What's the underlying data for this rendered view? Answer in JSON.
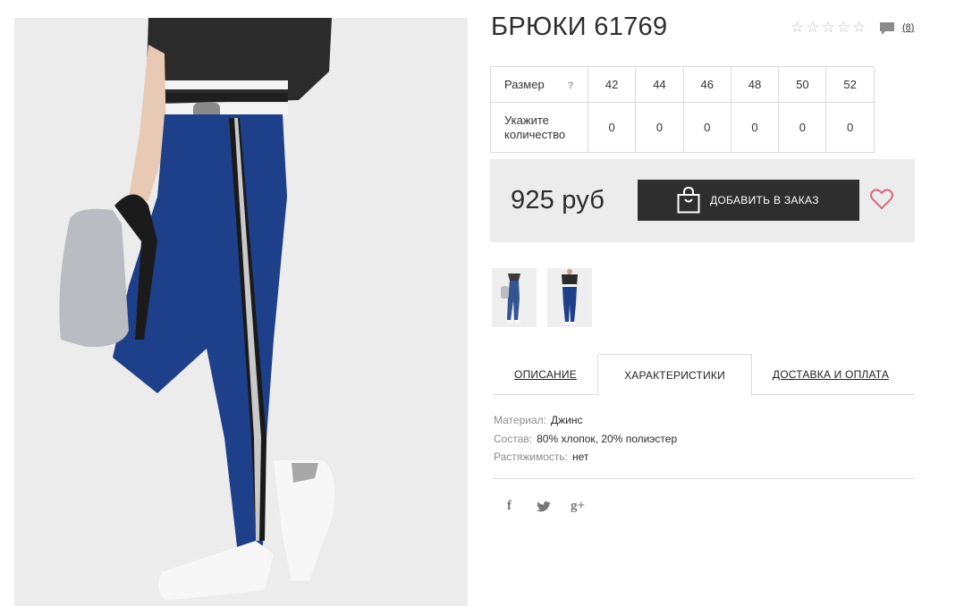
{
  "product": {
    "title": "БРЮКИ 61769",
    "reviews_count": "(8)",
    "rating_icon": "star-outline-icon"
  },
  "size_table": {
    "size_label": "Размер",
    "help": "?",
    "sizes": [
      "42",
      "44",
      "46",
      "48",
      "50",
      "52"
    ],
    "quantity_label": "Укажите количество",
    "quantities": [
      "0",
      "0",
      "0",
      "0",
      "0",
      "0"
    ]
  },
  "purchase": {
    "price": "925 руб",
    "add_button": "ДОБАВИТЬ В ЗАКАЗ",
    "button_bg": "#2e2e2e",
    "heart_color": "#d9687d"
  },
  "tabs": [
    {
      "label": "ОПИСАНИЕ",
      "active": false
    },
    {
      "label": "ХАРАКТЕРИСТИКИ",
      "active": true
    },
    {
      "label": "ДОСТАВКА И ОПЛАТА",
      "active": false
    }
  ],
  "characteristics": [
    {
      "label": "Материал:",
      "value": "Джинс"
    },
    {
      "label": "Состав:",
      "value": "80% хлопок, 20% полиэстер"
    },
    {
      "label": "Растяжимость:",
      "value": "нет"
    }
  ],
  "social": {
    "facebook": "f",
    "twitter": "🐦",
    "google_plus": "g+"
  }
}
